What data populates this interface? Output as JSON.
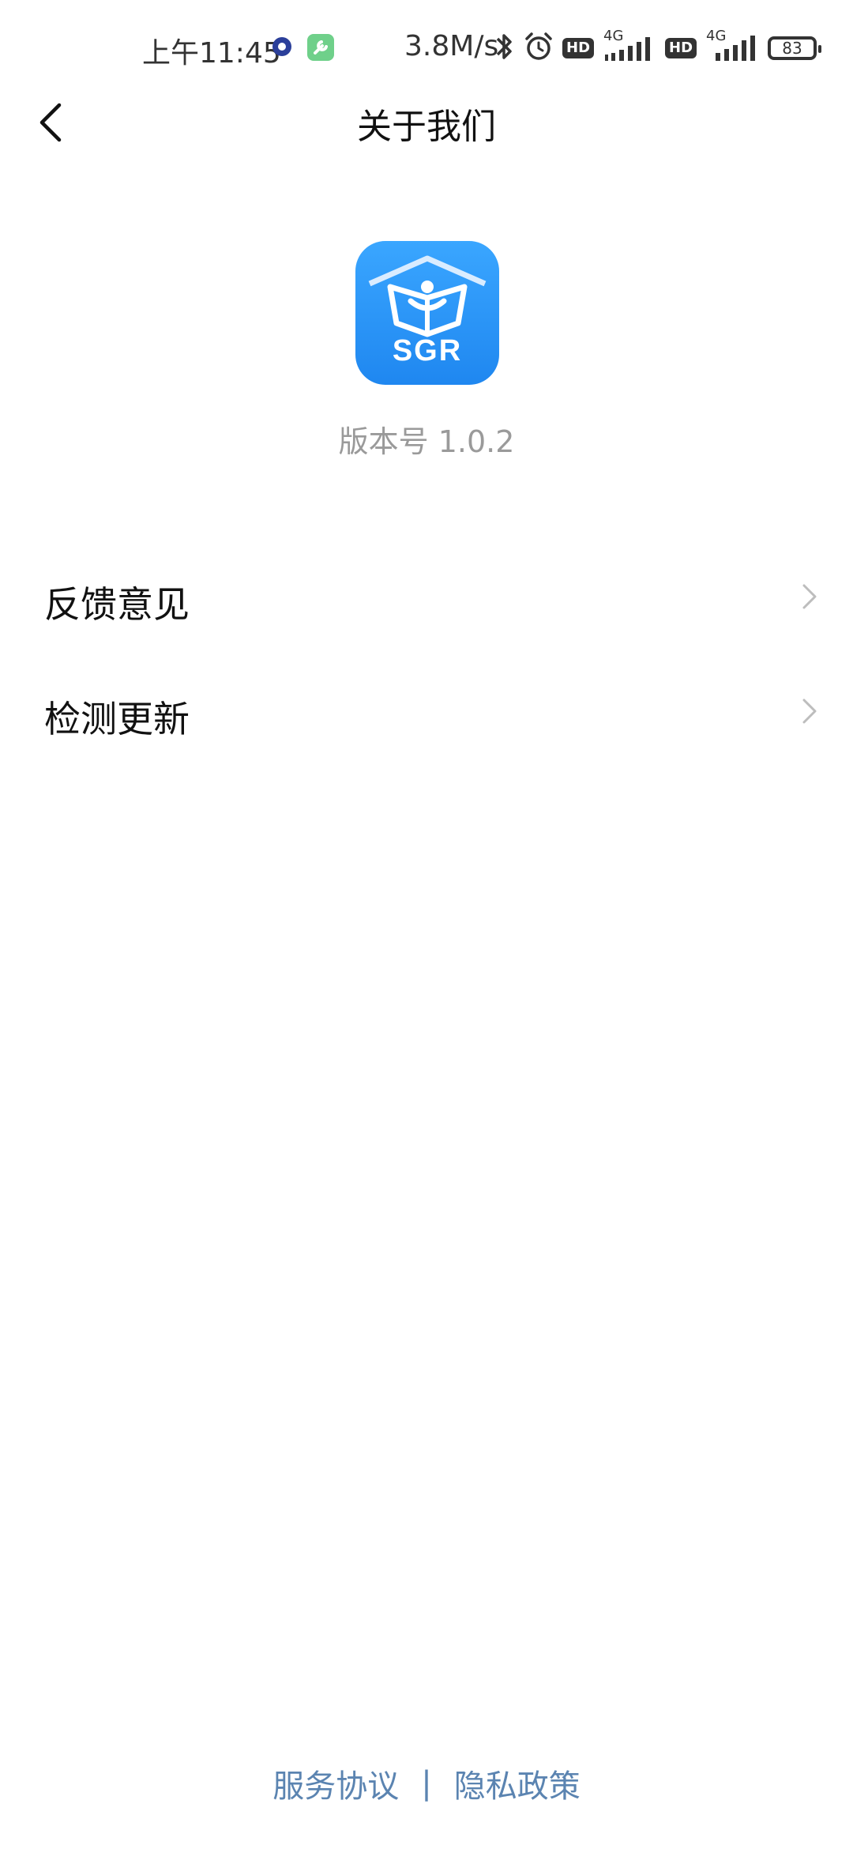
{
  "status_bar": {
    "time": "上午11:45",
    "network_speed": "3.8M/s",
    "hd_label": "HD",
    "network_type": "4G",
    "battery": "83"
  },
  "header": {
    "title": "关于我们"
  },
  "app": {
    "logo_text": "SGR",
    "version": "版本号 1.0.2"
  },
  "menu": {
    "items": [
      {
        "label": "反馈意见"
      },
      {
        "label": "检测更新"
      }
    ]
  },
  "footer": {
    "service_agreement": "服务协议",
    "divider": "|",
    "privacy_policy": "隐私政策"
  },
  "colors": {
    "accent_blue": "#2a90f5",
    "link": "#5b84b1",
    "muted": "#9a9a9a"
  }
}
